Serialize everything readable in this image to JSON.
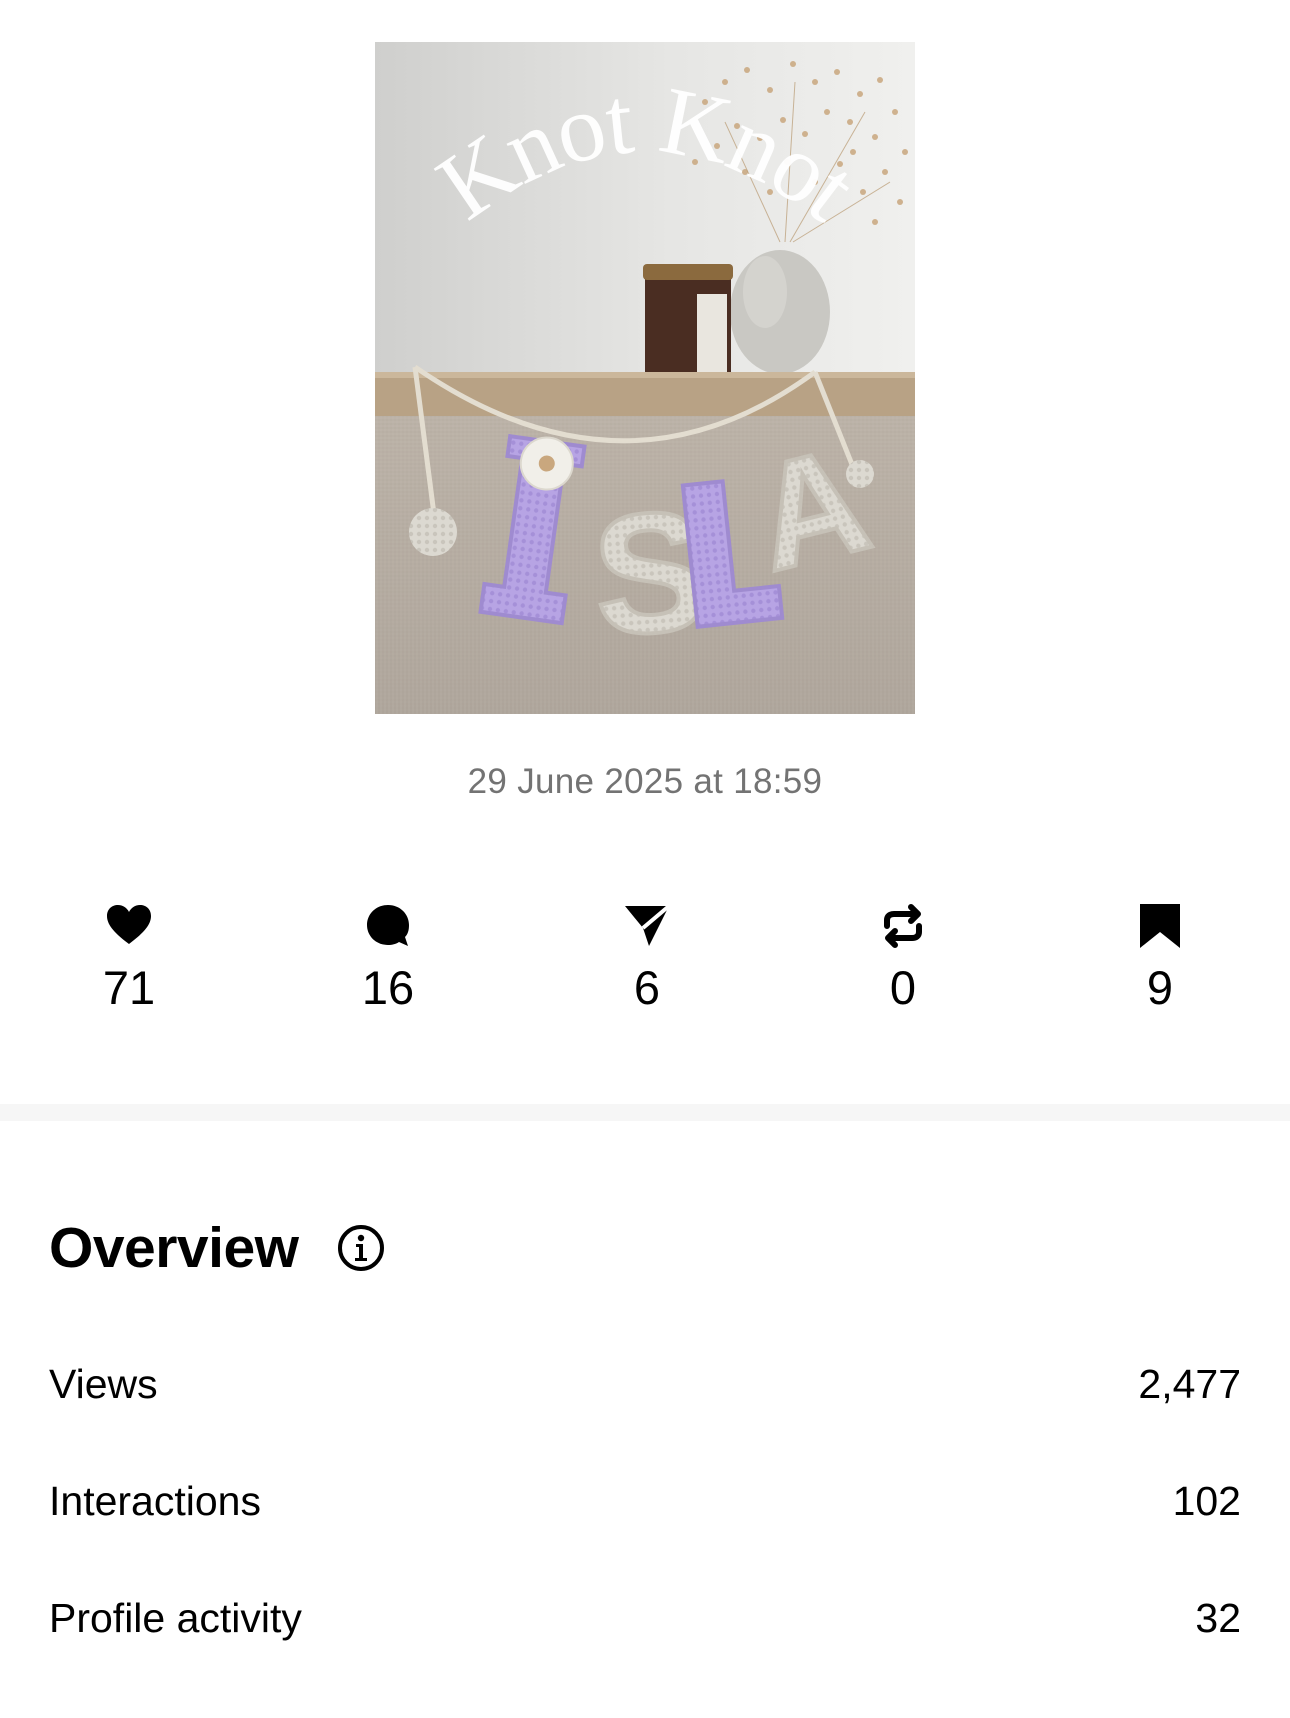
{
  "post": {
    "image_alt": "Crochet name garland spelling ISLA hanging from a shelf",
    "overlay_text": "Knot Knot",
    "garland_text": "ISLA",
    "timestamp": "29 June 2025 at 18:59"
  },
  "stats": [
    {
      "icon": "heart-icon",
      "count": "71"
    },
    {
      "icon": "comment-icon",
      "count": "16"
    },
    {
      "icon": "send-icon",
      "count": "6"
    },
    {
      "icon": "repost-icon",
      "count": "0"
    },
    {
      "icon": "bookmark-icon",
      "count": "9"
    }
  ],
  "overview": {
    "title": "Overview",
    "info_icon": "info-icon",
    "metrics": [
      {
        "label": "Views",
        "value": "2,477"
      },
      {
        "label": "Interactions",
        "value": "102"
      },
      {
        "label": "Profile activity",
        "value": "32"
      }
    ]
  },
  "colors": {
    "text": "#000000",
    "muted": "#737373",
    "divider": "#f6f6f6",
    "lilac": "#b9a6e6",
    "cream": "#dedbd3"
  }
}
